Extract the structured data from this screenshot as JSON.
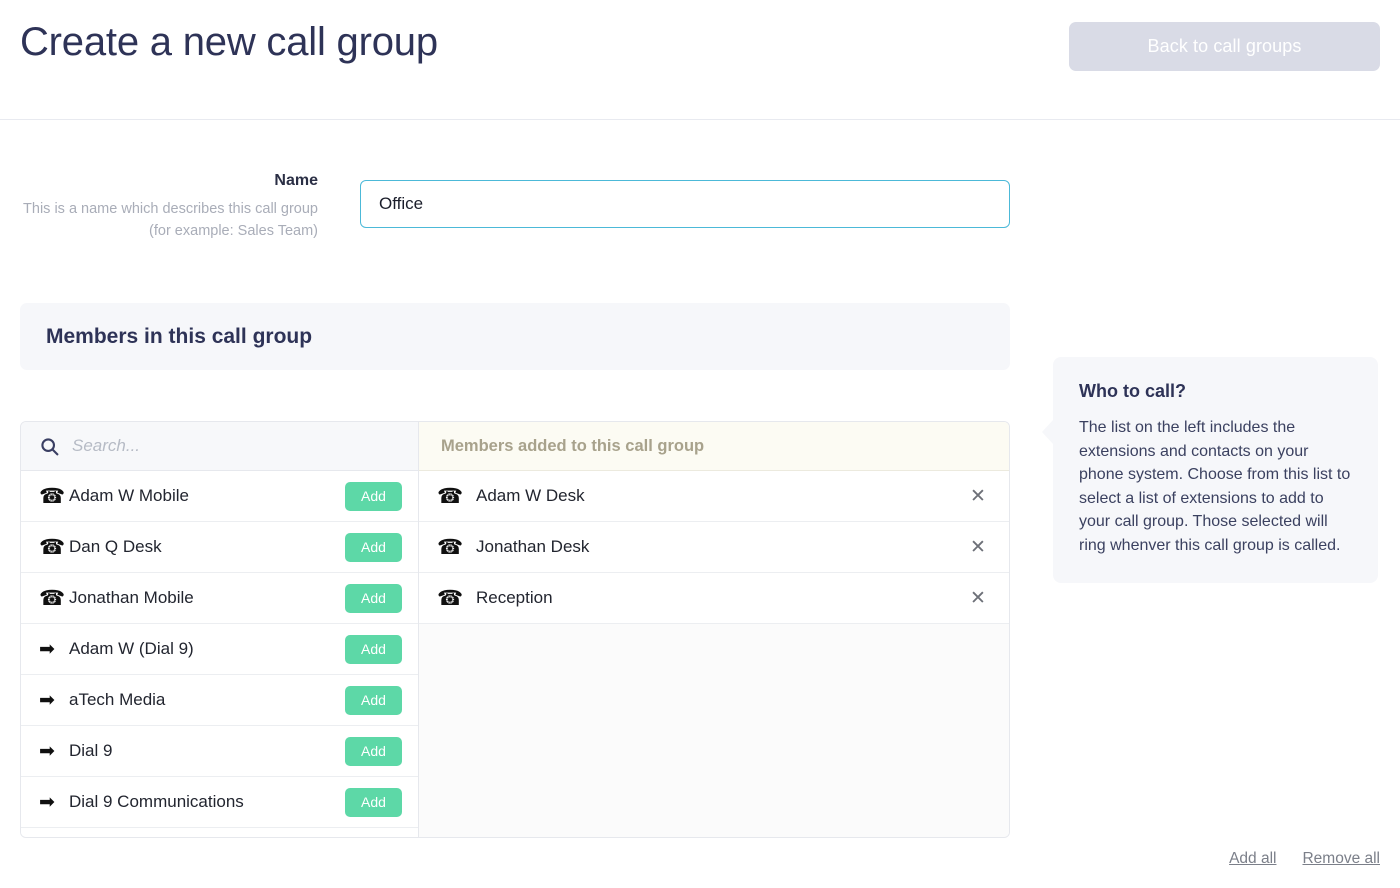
{
  "header": {
    "title": "Create a new call group",
    "back_button": "Back to call groups"
  },
  "name_field": {
    "label": "Name",
    "help": "This is a name which describes this call group (for example: Sales Team)",
    "value": "Office",
    "placeholder": ""
  },
  "members_section": {
    "title": "Members in this call group"
  },
  "available_list": {
    "search_placeholder": "Search...",
    "search_value": "",
    "search_icon": "search-icon",
    "add_label": "Add",
    "items": [
      {
        "icon": "phone-icon",
        "label": "Adam W Mobile"
      },
      {
        "icon": "phone-icon",
        "label": "Dan Q Desk"
      },
      {
        "icon": "phone-icon",
        "label": "Jonathan Mobile"
      },
      {
        "icon": "arrow-right-icon",
        "label": "Adam W (Dial 9)"
      },
      {
        "icon": "arrow-right-icon",
        "label": "aTech Media"
      },
      {
        "icon": "arrow-right-icon",
        "label": "Dial 9"
      },
      {
        "icon": "arrow-right-icon",
        "label": "Dial 9 Communications"
      }
    ]
  },
  "added_list": {
    "header": "Members added to this call group",
    "remove_icon": "close-icon",
    "items": [
      {
        "icon": "phone-icon",
        "label": "Adam W Desk"
      },
      {
        "icon": "phone-icon",
        "label": "Jonathan Desk"
      },
      {
        "icon": "phone-icon",
        "label": "Reception"
      }
    ]
  },
  "footer": {
    "add_all": "Add all",
    "remove_all": "Remove all"
  },
  "info_panel": {
    "title": "Who to call?",
    "body": "The list on the left includes the extensions and contacts on your phone system. Choose from this list to select a list of extensions to add to your call group. Those selected will ring whenver this call group is called."
  },
  "icons": {
    "phone": "☎",
    "arrow_right": "➡",
    "close": "✕"
  },
  "colors": {
    "title_navy": "#2e3357",
    "accent_green": "#5dd8a7",
    "input_focus": "#4cb9d8",
    "back_button": "#d9dbe6",
    "panel_bg": "#f6f7fa",
    "added_header_bg": "#fcfbf3"
  }
}
